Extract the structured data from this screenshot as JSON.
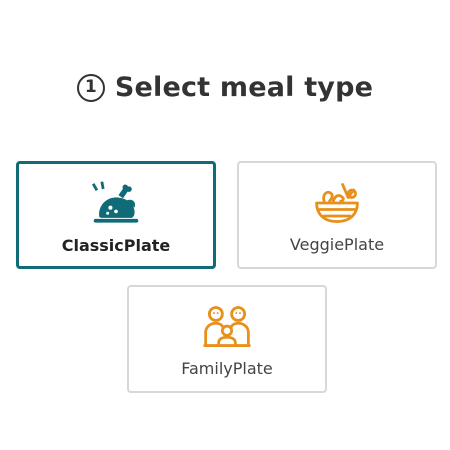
{
  "header": {
    "step_number": "1",
    "title": "Select meal type"
  },
  "options": [
    {
      "label": "ClassicPlate",
      "icon": "roast-chicken-icon",
      "selected": true
    },
    {
      "label": "VeggiePlate",
      "icon": "salad-bowl-icon",
      "selected": false
    },
    {
      "label": "FamilyPlate",
      "icon": "family-icon",
      "selected": false
    }
  ],
  "colors": {
    "selected_border": "#0f6b78",
    "classic_icon": "#0f6b78",
    "veggie_icon": "#e8901c",
    "family_icon": "#e8901c",
    "card_border": "#d8d8d8",
    "text": "#333333"
  }
}
